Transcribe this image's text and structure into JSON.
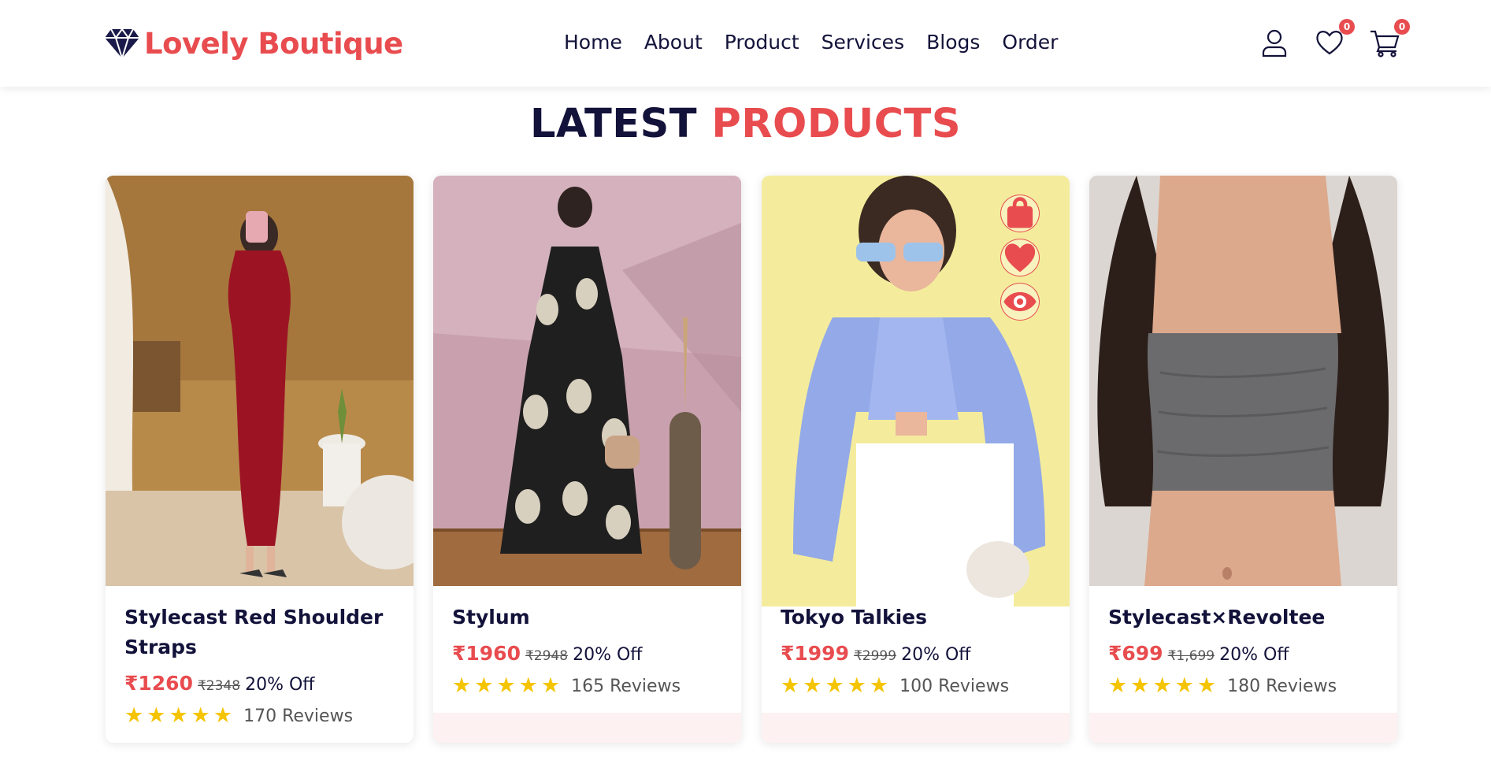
{
  "brand": {
    "name": "Lovely Boutique",
    "icon": "diamond-icon",
    "color": "#e84c4f"
  },
  "nav": {
    "items": [
      {
        "label": "Home"
      },
      {
        "label": "About"
      },
      {
        "label": "Product"
      },
      {
        "label": "Services"
      },
      {
        "label": "Blogs"
      },
      {
        "label": "Order"
      }
    ]
  },
  "header_icons": {
    "user": {
      "icon": "user-icon"
    },
    "wishlist": {
      "icon": "heart-icon",
      "count": "0"
    },
    "cart": {
      "icon": "cart-icon",
      "count": "0"
    }
  },
  "section": {
    "title_part1": "LATEST",
    "title_part2": "PRODUCTS"
  },
  "products": [
    {
      "name": "Stylecast Red Shoulder Straps",
      "price": "₹1260",
      "old_price": "₹2348",
      "discount": "20% Off",
      "rating": 5,
      "reviews": "170 Reviews"
    },
    {
      "name": "Stylum",
      "price": "₹1960",
      "old_price": "₹2948",
      "discount": "20% Off",
      "rating": 5,
      "reviews": "165 Reviews"
    },
    {
      "name": "Tokyo Talkies",
      "price": "₹1999",
      "old_price": "₹2999",
      "discount": "20% Off",
      "rating": 5,
      "reviews": "100 Reviews",
      "actions": [
        "bag-icon",
        "heart-icon",
        "eye-icon"
      ]
    },
    {
      "name": "Stylecast×Revoltee",
      "price": "₹699",
      "old_price": "₹1,699",
      "discount": "20% Off",
      "rating": 5,
      "reviews": "180 Reviews"
    }
  ],
  "colors": {
    "accent": "#e84c4f",
    "navy": "#12123a",
    "star": "#f5c400"
  }
}
